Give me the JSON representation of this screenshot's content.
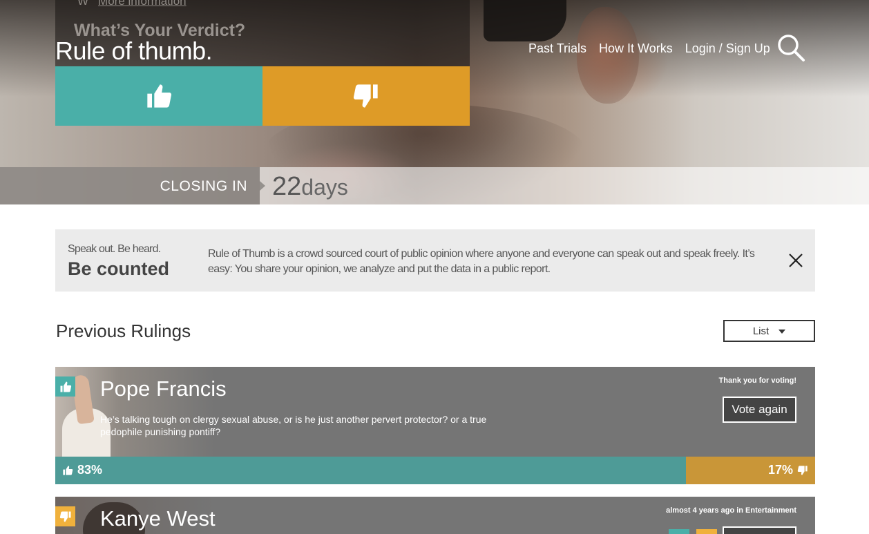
{
  "header": {
    "more_info": "More information",
    "more_info_prefix": "W",
    "verdict_question": "What’s Your Verdict?",
    "brand": "Rule of thumb.",
    "nav": [
      "Past Trials",
      "How It Works",
      "Login / Sign Up"
    ]
  },
  "closing": {
    "label": "CLOSING IN",
    "value": "22",
    "unit": "days"
  },
  "banner": {
    "tagline": "Speak out. Be heard.",
    "heading": "Be counted",
    "text": "Rule of Thumb is a crowd sourced court of public opinion where anyone and everyone can speak out and speak freely. It’s easy: You share your opinion, we analyze and put the data in a public report."
  },
  "rulings": {
    "title": "Previous Rulings",
    "view_select": "List",
    "cards": [
      {
        "name": "Pope Francis",
        "description": "He’s talking tough on clergy sexual abuse, or is he just another pervert protector? or a true pedophile punishing pontiff?",
        "meta": "Thank you for voting!",
        "button": "Vote again",
        "badge": "thumbs-up",
        "up_percent": 83,
        "down_percent": 17,
        "up_label": "83%",
        "down_label": "17%"
      },
      {
        "name": "Kanye West",
        "meta": "almost 4 years ago in Entertainment",
        "badge": "thumbs-down"
      }
    ]
  },
  "colors": {
    "thumbs_up": "#4aafa8",
    "thumbs_down": "#de9b27",
    "bar_up": "#4e9b97",
    "bar_down": "#c99638",
    "card_bg": "#757575"
  }
}
